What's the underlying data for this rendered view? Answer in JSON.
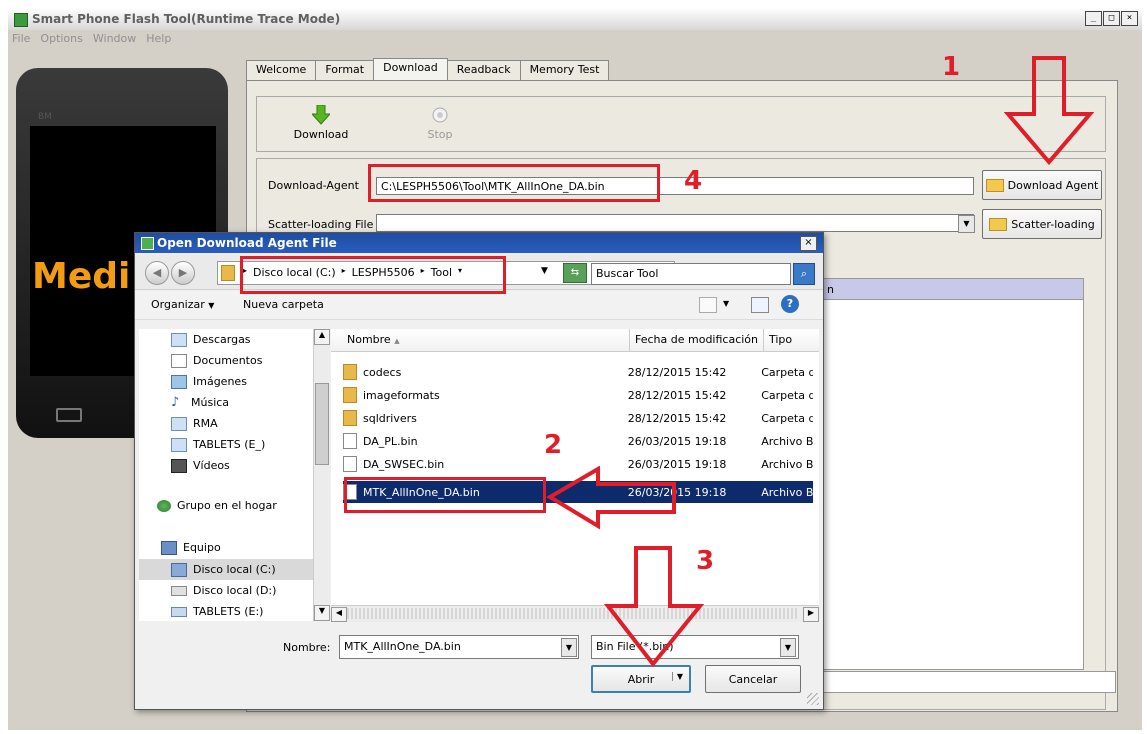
{
  "window": {
    "title": "Smart Phone Flash Tool(Runtime Trace Mode)",
    "caption_buttons": [
      "_",
      "□",
      "×"
    ],
    "menu": [
      "File",
      "Options",
      "Window",
      "Help"
    ]
  },
  "phone": {
    "brand": "BM",
    "screen_text": "Medi"
  },
  "tabs": [
    "Welcome",
    "Format",
    "Download",
    "Readback",
    "Memory Test"
  ],
  "active_tab": "Download",
  "toolbar": {
    "download_label": "Download",
    "stop_label": "Stop"
  },
  "form": {
    "download_agent_label": "Download-Agent",
    "download_agent_value": "C:\\LESPH5506\\Tool\\MTK_AllInOne_DA.bin",
    "download_agent_button": "Download Agent",
    "scatter_label": "Scatter-loading File",
    "scatter_value": "",
    "scatter_button": "Scatter-loading",
    "partial_header": "n"
  },
  "annotations": {
    "n1": "1",
    "n2": "2",
    "n3": "3",
    "n4": "4",
    "color": "#e01e2a"
  },
  "dialog": {
    "title": "Open Download Agent File",
    "breadcrumb": [
      "Disco local (C:)",
      "LESPH5506",
      "Tool"
    ],
    "search_placeholder": "Buscar Tool",
    "organize_label": "Organizar",
    "new_folder_label": "Nueva carpeta",
    "nav_items": [
      {
        "label": "Descargas",
        "icon": "download-folder-icon"
      },
      {
        "label": "Documentos",
        "icon": "documents-icon"
      },
      {
        "label": "Imágenes",
        "icon": "pictures-icon"
      },
      {
        "label": "Música",
        "icon": "music-icon"
      },
      {
        "label": "RMA",
        "icon": "folder-icon"
      },
      {
        "label": "TABLETS (E_)",
        "icon": "folder-icon"
      },
      {
        "label": "Vídeos",
        "icon": "videos-icon"
      }
    ],
    "homegroup_label": "Grupo en el hogar",
    "computer_label": "Equipo",
    "drives": [
      {
        "label": "Disco local (C:)",
        "selected": true
      },
      {
        "label": "Disco local (D:)",
        "selected": false
      },
      {
        "label": "TABLETS (E:)",
        "selected": false
      }
    ],
    "columns": [
      "Nombre",
      "Fecha de modificación",
      "Tipo"
    ],
    "files": [
      {
        "name": "codecs",
        "date": "28/12/2015 15:42",
        "type": "Carpeta d",
        "kind": "folder",
        "selected": false
      },
      {
        "name": "imageformats",
        "date": "28/12/2015 15:42",
        "type": "Carpeta d",
        "kind": "folder",
        "selected": false
      },
      {
        "name": "sqldrivers",
        "date": "28/12/2015 15:42",
        "type": "Carpeta d",
        "kind": "folder",
        "selected": false
      },
      {
        "name": "DA_PL.bin",
        "date": "26/03/2015 19:18",
        "type": "Archivo B",
        "kind": "file",
        "selected": false
      },
      {
        "name": "DA_SWSEC.bin",
        "date": "26/03/2015 19:18",
        "type": "Archivo B",
        "kind": "file",
        "selected": false
      },
      {
        "name": "MTK_AllInOne_DA.bin",
        "date": "26/03/2015 19:18",
        "type": "Archivo B",
        "kind": "file",
        "selected": true
      }
    ],
    "filename_label": "Nombre:",
    "filename_value": "MTK_AllInOne_DA.bin",
    "filter_value": "Bin File (*.bin)",
    "open_button": "Abrir",
    "cancel_button": "Cancelar",
    "close_glyph": "×"
  }
}
